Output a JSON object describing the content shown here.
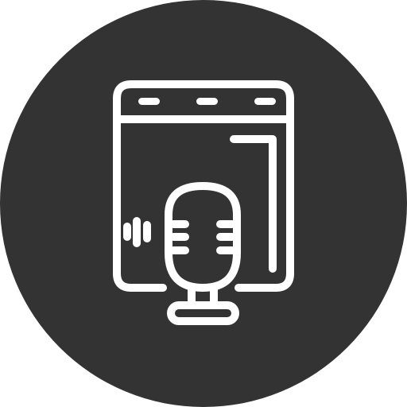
{
  "icon": {
    "name": "browser-podcast-microphone-icon",
    "background_color": "#333333",
    "stroke_color": "#ffffff"
  }
}
